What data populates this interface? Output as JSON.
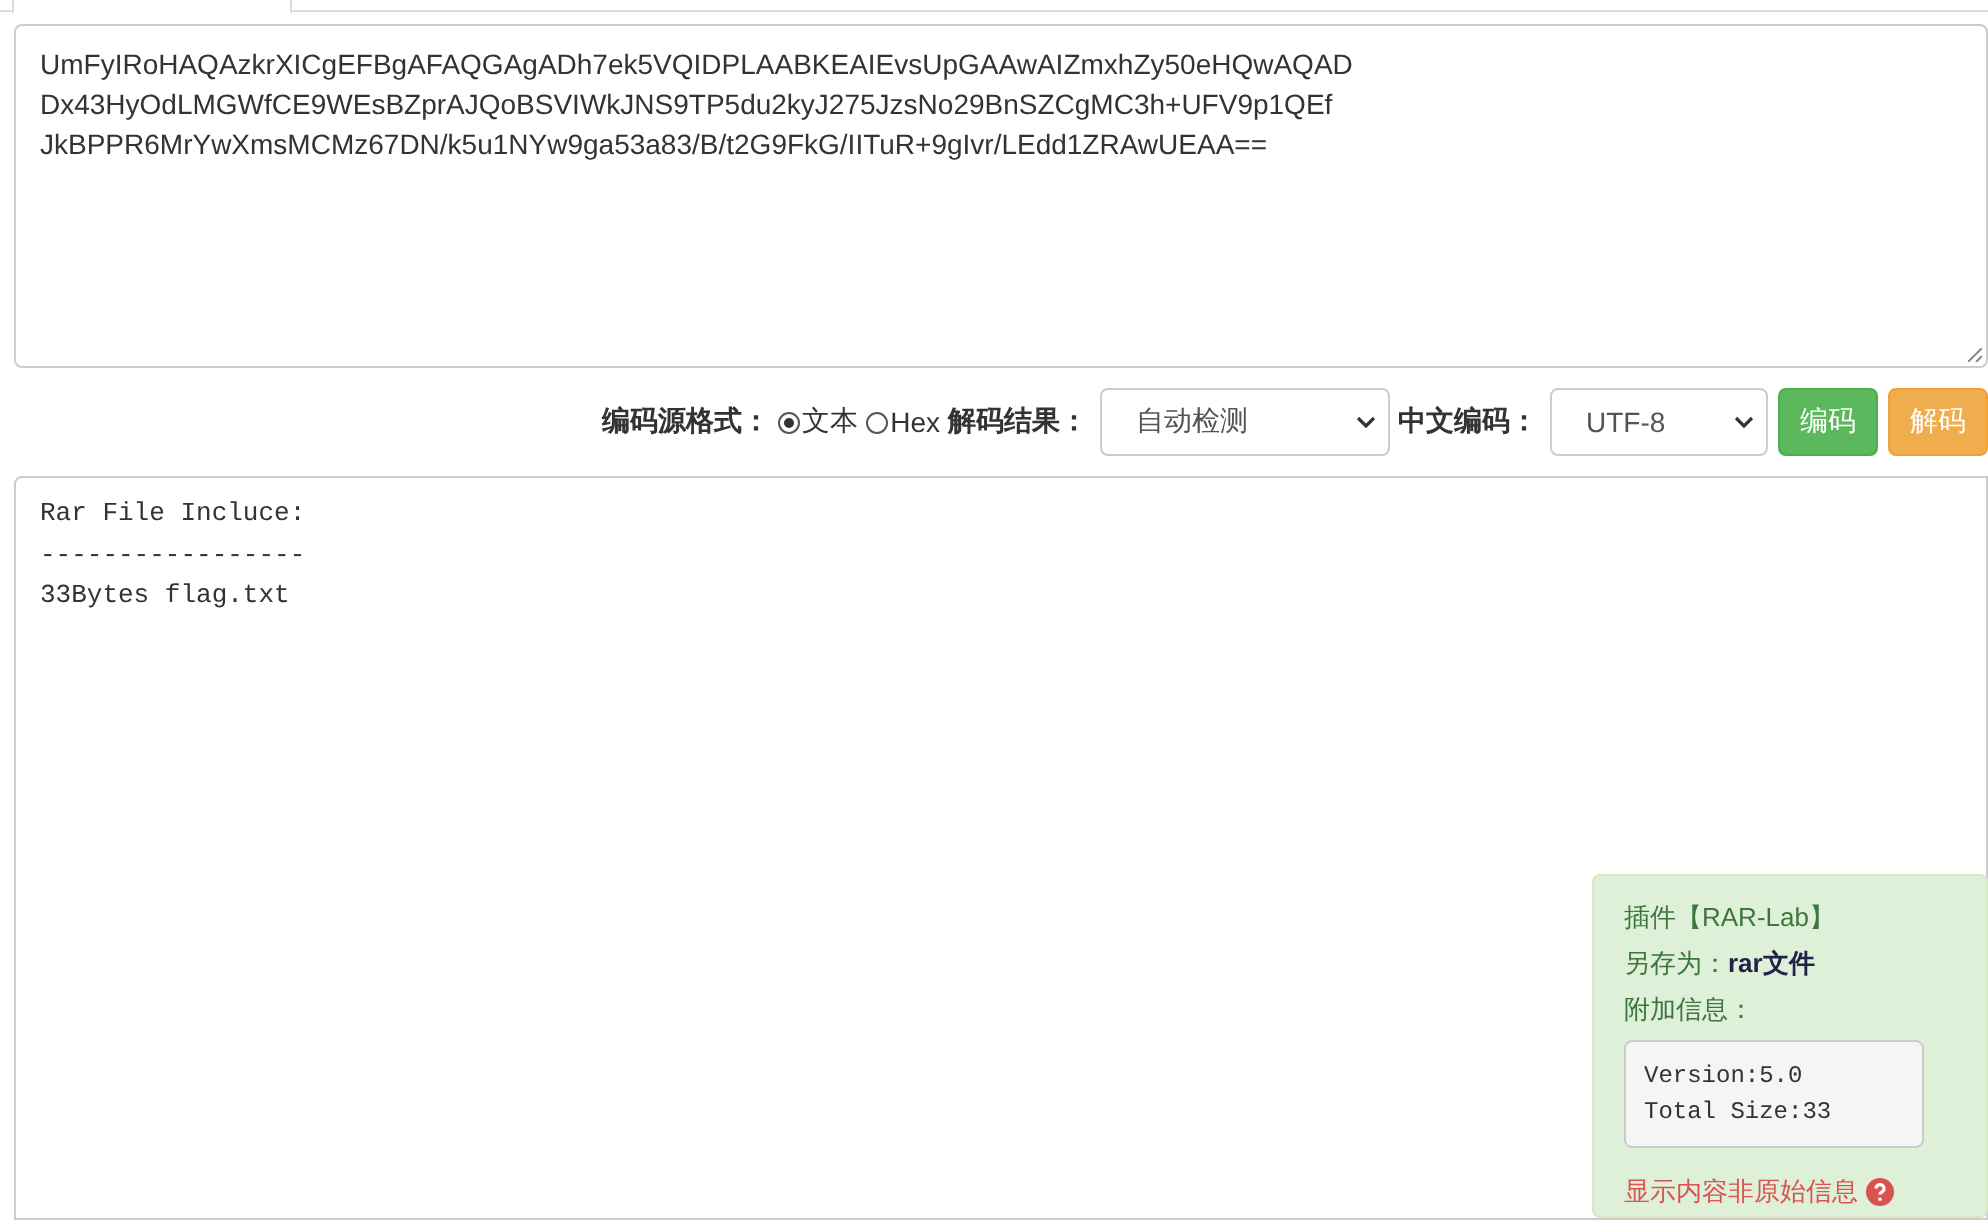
{
  "input": {
    "lines": [
      "UmFyIRoHAQAzkrXICgEFBgAFAQGAgADh7ek5VQIDPLAABKEAIEvsUpGAAwAIZmxhZy50eHQwAQAD",
      "Dx43HyOdLMGWfCE9WEsBZprAJQoBSVIWkJNS9TP5du2kyJ275JzsNo29BnSZCgMC3h+UFV9p1QEf",
      "JkBPPR6MrYwXmsMCMz67DN/k5u1NYw9ga53a83/B/t2G9FkG/IITuR+9gIvr/LEdd1ZRAwUEAA=="
    ]
  },
  "controls": {
    "source_label": "编码源格式：",
    "source_options": [
      {
        "label": "文本",
        "selected": true
      },
      {
        "label": "Hex",
        "selected": false
      }
    ],
    "result_label": "解码结果：",
    "result_select": "自动检测",
    "charset_label": "中文编码：",
    "charset_select": "UTF-8",
    "buttons": [
      {
        "label": "编码",
        "kind": "success"
      },
      {
        "label": "解码",
        "kind": "warning"
      }
    ]
  },
  "output": {
    "lines": [
      "Rar File Incluce:",
      "-----------------",
      "33Bytes flag.txt"
    ]
  },
  "plugin": {
    "title": "插件【RAR-Lab】",
    "save_as_label": "另存为：",
    "save_as_value": "rar文件",
    "extra_label": "附加信息：",
    "info_lines": [
      "Version:5.0",
      "Total Size:33"
    ],
    "warning": "显示内容非原始信息"
  }
}
